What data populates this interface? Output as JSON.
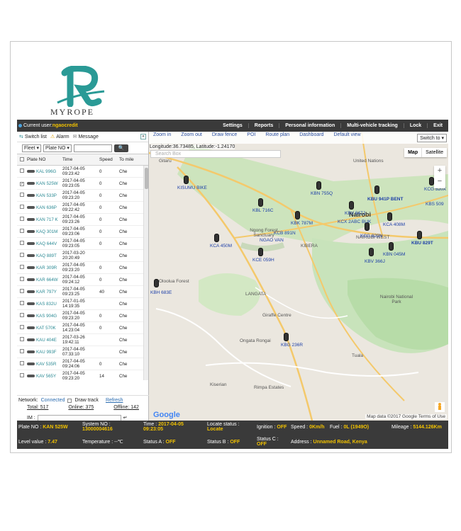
{
  "brand": {
    "name": "MYROPE"
  },
  "topbar": {
    "user_label": "Current user:",
    "user_name": "ngaocredit",
    "nav": [
      "Settings",
      "Reports",
      "Personal information",
      "Multi-vehicle tracking",
      "Lock",
      "Exit"
    ]
  },
  "left": {
    "toolbar": {
      "switch_list": "Switch list",
      "alarm": "Alarm",
      "message": "Message",
      "collapse": "«"
    },
    "filter": {
      "fleet": "Fleet",
      "plate": "Plate NO",
      "search_btn": "🔍"
    },
    "columns": [
      "Plate NO",
      "Time",
      "Speed",
      "To mile"
    ],
    "rows": [
      {
        "plate": "KAL 996G",
        "time": "2017-04-05 09:23:42",
        "speed": "0",
        "mile": "Che",
        "checked": false
      },
      {
        "plate": "KAN 525W",
        "time": "2017-04-05 09:23:05",
        "speed": "0",
        "mile": "Che",
        "checked": true
      },
      {
        "plate": "KAN 533P",
        "time": "2017-04-05 09:23:20",
        "speed": "0",
        "mile": "Che",
        "checked": false
      },
      {
        "plate": "KAN 636P",
        "time": "2017-04-05 09:22:42",
        "speed": "0",
        "mile": "Che",
        "checked": false
      },
      {
        "plate": "KAN 717 K",
        "time": "2017-04-05 09:23:26",
        "speed": "0",
        "mile": "Che",
        "checked": false
      },
      {
        "plate": "KAQ 301M",
        "time": "2017-04-05 09:23:06",
        "speed": "0",
        "mile": "Che",
        "checked": false
      },
      {
        "plate": "KAQ 644V",
        "time": "2017-04-05 09:23:05",
        "speed": "0",
        "mile": "Che",
        "checked": false
      },
      {
        "plate": "KAQ 889T",
        "time": "2017-03-20 20:20:49",
        "speed": "",
        "mile": "Che",
        "checked": false
      },
      {
        "plate": "KAR 309R",
        "time": "2017-04-05 09:23:20",
        "speed": "0",
        "mile": "Che",
        "checked": false
      },
      {
        "plate": "KAR 664W",
        "time": "2017-04-05 09:24:12",
        "speed": "0",
        "mile": "Che",
        "checked": false
      },
      {
        "plate": "KAR 797Y",
        "time": "2017-04-05 09:23:25",
        "speed": "40",
        "mile": "Che",
        "checked": false
      },
      {
        "plate": "KAS 832U",
        "time": "2017-01-05 14:19:35",
        "speed": "",
        "mile": "Che",
        "checked": false
      },
      {
        "plate": "KAS 904G",
        "time": "2017-04-05 09:23:20",
        "speed": "0",
        "mile": "Che",
        "checked": false
      },
      {
        "plate": "KAT 570K",
        "time": "2017-04-05 14:23:04",
        "speed": "0",
        "mile": "Che",
        "checked": false
      },
      {
        "plate": "KAU 404E",
        "time": "2017-03-26 19:42:11",
        "speed": "",
        "mile": "Che",
        "checked": false
      },
      {
        "plate": "KAU 993F",
        "time": "2017-04-05 07:33:10",
        "speed": "",
        "mile": "Che",
        "checked": false
      },
      {
        "plate": "KAV 535R",
        "time": "2017-04-05 09:24:06",
        "speed": "0",
        "mile": "Che",
        "checked": false
      },
      {
        "plate": "KAV 565Y",
        "time": "2017-04-05 09:23:20",
        "speed": "14",
        "mile": "Che",
        "checked": false
      }
    ],
    "network_label": "Network:",
    "network_value": "Connected",
    "draw_track": "Draw track",
    "refresh": "Refresh",
    "total": "Total: 517",
    "online": "Online: 375",
    "offline": "Offline: 142",
    "im_label": "IM :"
  },
  "map": {
    "tools": [
      "Zoom in",
      "Zoom out",
      "Draw fence",
      "POI",
      "Route plan",
      "Dashboard",
      "Default view"
    ],
    "switch_to": "Switch to",
    "coords": "Longitude:36.73485, Latitude:-1.24170",
    "search_placeholder": "Search Box",
    "map_type": [
      "Map",
      "Satellite"
    ],
    "zoom": [
      "+",
      "−"
    ],
    "google": "Google",
    "attribution": "Map data ©2017 Google   Terms of Use",
    "places": [
      "Gitaru",
      "United Nations",
      "Nairobi",
      "NAIROBI WEST",
      "Ngong Forest Sanctuary",
      "Oloolua Forest",
      "Giraffe Centre",
      "Ongata Rongai",
      "Tuala",
      "Kiserian",
      "Rimpa Estates",
      "Nairobi National Park",
      "LANGATA",
      "KIBERA"
    ],
    "vehicles": [
      "KISUMU BIKE",
      "KBN 755Q",
      "KBL 716C",
      "KBV 647J",
      "KBU 941P BENT",
      "KCG 520X",
      "KBS 509",
      "KBK 787M",
      "KCA 408M",
      "KCB 891N",
      "KCG 829N",
      "KBU 829T",
      "KCA 450M",
      "NGAO VAN",
      "KCE 059H",
      "KBN 045M",
      "KBV 366J",
      "KBH 683E",
      "KBG 236R",
      "KCX 2ABC BUK"
    ]
  },
  "status": {
    "plate_label": "Plate NO :",
    "plate": "KAN 525W",
    "system_label": "System NO :",
    "system": "13000004616",
    "time_label": "Time :",
    "time": "2017-04-05 09:23:05",
    "locate_label": "Locate status :",
    "locate": "Locate",
    "ignition_label": "Ignition :",
    "ignition": "OFF",
    "speed_label": "Speed :",
    "speed": "0Km/h",
    "fuel_label": "Fuel :",
    "fuel": "0L (1949O)",
    "mileage_label": "Mileage :",
    "mileage": "5144.126Km",
    "level_label": "Level value :",
    "level": "7.47",
    "temp_label": "Temperature :",
    "temp": "--℃",
    "statusa_label": "Status A :",
    "statusa": "OFF",
    "statusb_label": "Status B :",
    "statusb": "OFF",
    "statusc_label": "Status C :",
    "statusc": "OFF",
    "address_label": "Address :",
    "address": "Unnamed Road, Kenya"
  },
  "colors": {
    "accent": "#f2c200",
    "bar": "#3a3a3a",
    "link": "#2b6cb0",
    "logo": "#2a9a96"
  }
}
